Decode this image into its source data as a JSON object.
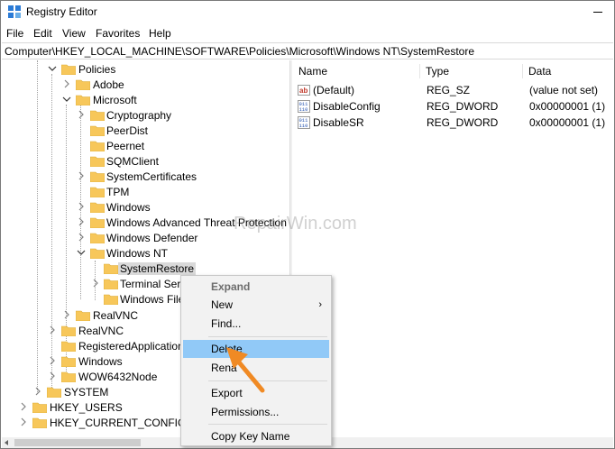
{
  "window": {
    "title": "Registry Editor"
  },
  "menubar": {
    "items": [
      "File",
      "Edit",
      "View",
      "Favorites",
      "Help"
    ]
  },
  "address": {
    "path": "Computer\\HKEY_LOCAL_MACHINE\\SOFTWARE\\Policies\\Microsoft\\Windows NT\\SystemRestore"
  },
  "tree": {
    "items": [
      {
        "label": "Policies"
      },
      {
        "label": "Adobe"
      },
      {
        "label": "Microsoft"
      },
      {
        "label": "Cryptography"
      },
      {
        "label": "PeerDist"
      },
      {
        "label": "Peernet"
      },
      {
        "label": "SQMClient"
      },
      {
        "label": "SystemCertificates"
      },
      {
        "label": "TPM"
      },
      {
        "label": "Windows"
      },
      {
        "label": "Windows Advanced Threat Protection"
      },
      {
        "label": "Windows Defender"
      },
      {
        "label": "Windows NT"
      },
      {
        "label": "SystemRestore"
      },
      {
        "label": "Terminal Serv"
      },
      {
        "label": "Windows File"
      },
      {
        "label": "RealVNC"
      },
      {
        "label": "RealVNC"
      },
      {
        "label": "RegisteredApplications"
      },
      {
        "label": "Windows"
      },
      {
        "label": "WOW6432Node"
      },
      {
        "label": "SYSTEM"
      },
      {
        "label": "HKEY_USERS"
      },
      {
        "label": "HKEY_CURRENT_CONFIG"
      }
    ]
  },
  "list": {
    "headers": {
      "name": "Name",
      "type": "Type",
      "data": "Data"
    },
    "rows": [
      {
        "icon": "string-value-icon",
        "name": "(Default)",
        "type": "REG_SZ",
        "data": "(value not set)"
      },
      {
        "icon": "dword-value-icon",
        "name": "DisableConfig",
        "type": "REG_DWORD",
        "data": "0x00000001 (1)"
      },
      {
        "icon": "dword-value-icon",
        "name": "DisableSR",
        "type": "REG_DWORD",
        "data": "0x00000001 (1)"
      }
    ]
  },
  "context_menu": {
    "items": [
      {
        "label": "Expand"
      },
      {
        "label": "New",
        "submenu_glyph": "›"
      },
      {
        "label": "Find..."
      },
      {
        "label": "Delete"
      },
      {
        "label": "Rena"
      },
      {
        "label": "Export"
      },
      {
        "label": "Permissions..."
      },
      {
        "label": "Copy Key Name"
      }
    ]
  },
  "watermark": {
    "text": "RepairWin.com"
  },
  "colors": {
    "highlight": "#91c9f7",
    "folder": "#f7c75a",
    "annotation_arrow": "#f08a24"
  }
}
